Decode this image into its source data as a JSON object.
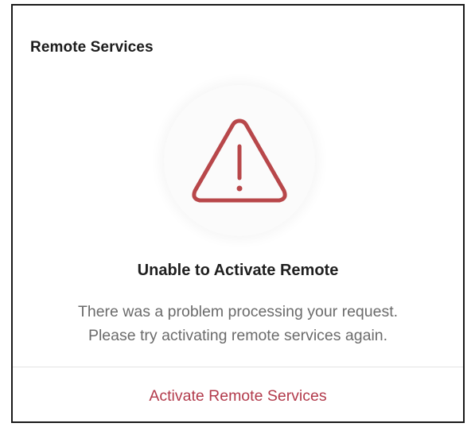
{
  "card": {
    "title": "Remote Services"
  },
  "icon": {
    "name": "warning-triangle-icon",
    "color": "#b8474a",
    "circle_color": "#fbfbfb"
  },
  "error": {
    "heading": "Unable to Activate Remote",
    "message_line1": "There was a problem processing your request.",
    "message_line2": "Please try activating remote services again."
  },
  "action": {
    "label": "Activate Remote Services",
    "color": "#b23a4b"
  }
}
